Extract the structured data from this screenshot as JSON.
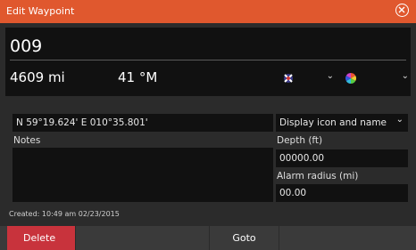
{
  "window": {
    "title": "Edit Waypoint"
  },
  "waypoint": {
    "name": "009",
    "distance": "4609 mi",
    "bearing": "41 °M",
    "position": "N 59°19.624'   E 010°35.801'",
    "display_option": "Display icon and name",
    "notes_label": "Notes",
    "notes_value": "",
    "depth_label": "Depth (ft)",
    "depth_value": "00000.00",
    "alarm_label": "Alarm radius (mi)",
    "alarm_value": "00.00",
    "created": "Created: 10:49 am  02/23/2015"
  },
  "icons": {
    "symbol": "waypoint-symbol-icon",
    "color": "color-wheel-icon",
    "close": "close-icon",
    "dropdown": "chevron-down-icon"
  },
  "colors": {
    "titlebar": "#e0582e",
    "delete": "#c8333c"
  },
  "footer": {
    "delete_label": "Delete",
    "goto_label": "Goto"
  }
}
